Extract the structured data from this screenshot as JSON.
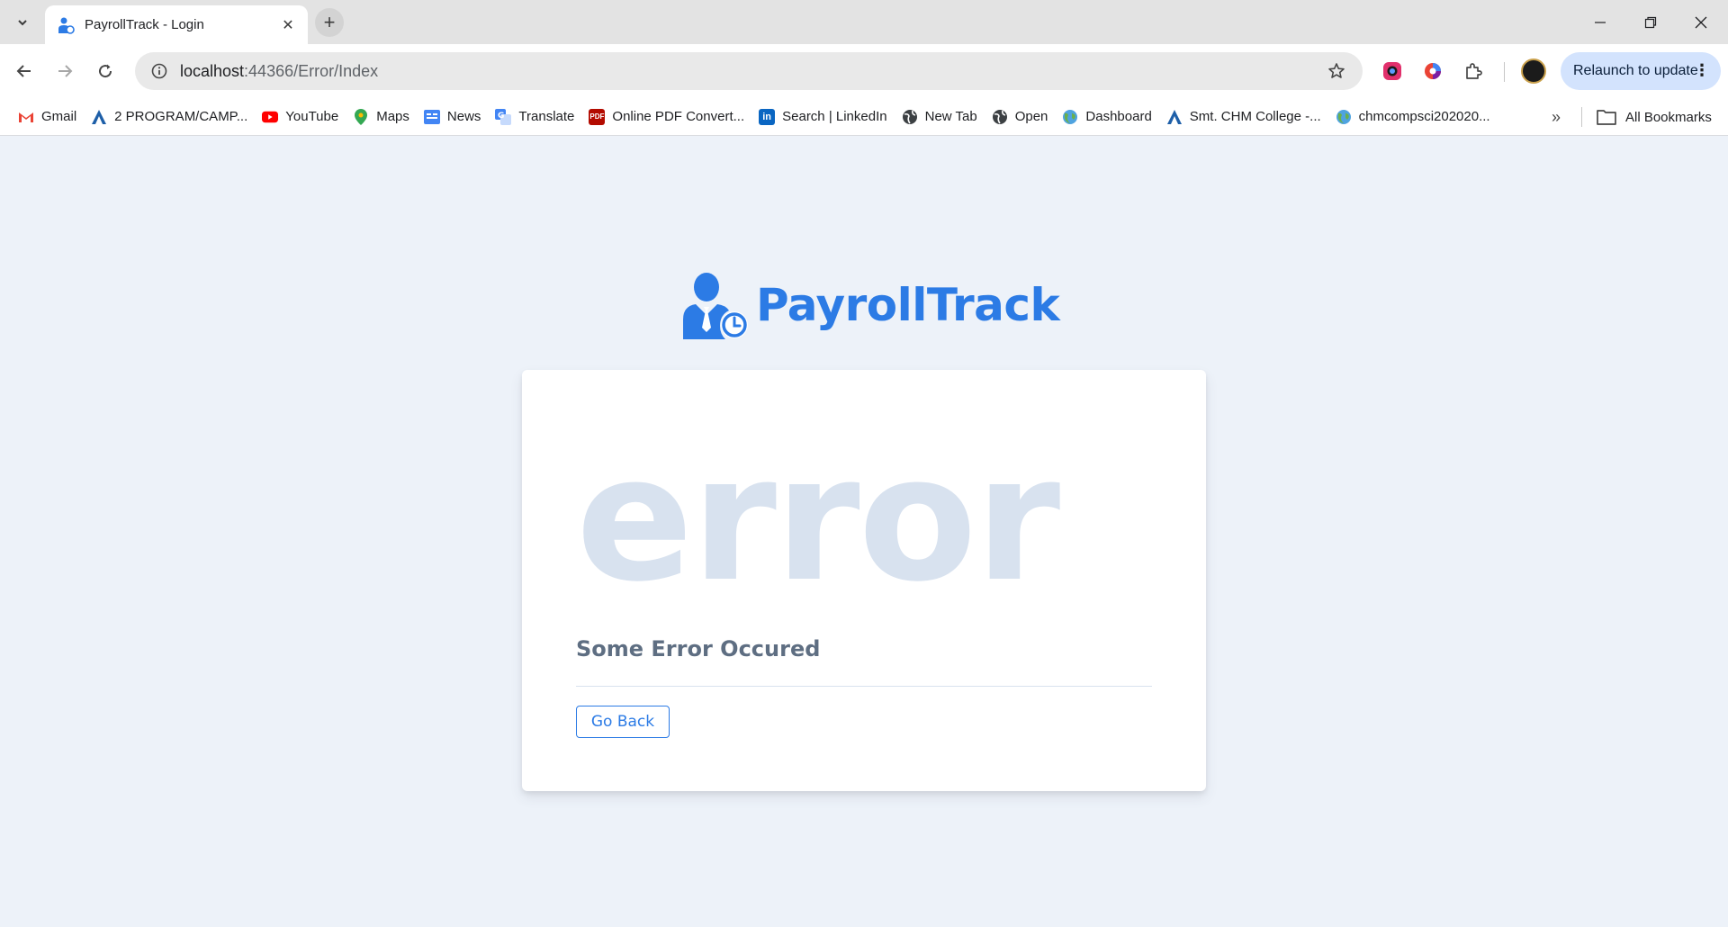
{
  "browser": {
    "tab": {
      "title": "PayrollTrack - Login"
    },
    "address": {
      "host": "localhost",
      "path": ":44366/Error/Index"
    },
    "relaunch_label": "Relaunch to update",
    "bookmarks": [
      {
        "label": "Gmail",
        "icon": "gmail-icon"
      },
      {
        "label": "2 PROGRAM/CAMP...",
        "icon": "program-icon"
      },
      {
        "label": "YouTube",
        "icon": "youtube-icon"
      },
      {
        "label": "Maps",
        "icon": "maps-icon"
      },
      {
        "label": "News",
        "icon": "news-icon"
      },
      {
        "label": "Translate",
        "icon": "translate-icon"
      },
      {
        "label": "Online PDF Convert...",
        "icon": "pdf-icon"
      },
      {
        "label": "Search | LinkedIn",
        "icon": "linkedin-icon"
      },
      {
        "label": "New Tab",
        "icon": "globe-icon"
      },
      {
        "label": "Open",
        "icon": "globe-icon"
      },
      {
        "label": "Dashboard",
        "icon": "earth-icon"
      },
      {
        "label": "Smt. CHM College -...",
        "icon": "college-icon"
      },
      {
        "label": "chmcompsci202020...",
        "icon": "earth-icon"
      }
    ],
    "all_bookmarks_label": "All Bookmarks"
  },
  "page": {
    "brand": "PayrollTrack",
    "error_code_text": "error",
    "message": "Some Error Occured",
    "go_back_label": "Go Back"
  },
  "colors": {
    "primary": "#2c7be5",
    "page_bg": "#edf2f9",
    "error_watermark": "#d8e2ef",
    "message": "#5e6e82"
  }
}
